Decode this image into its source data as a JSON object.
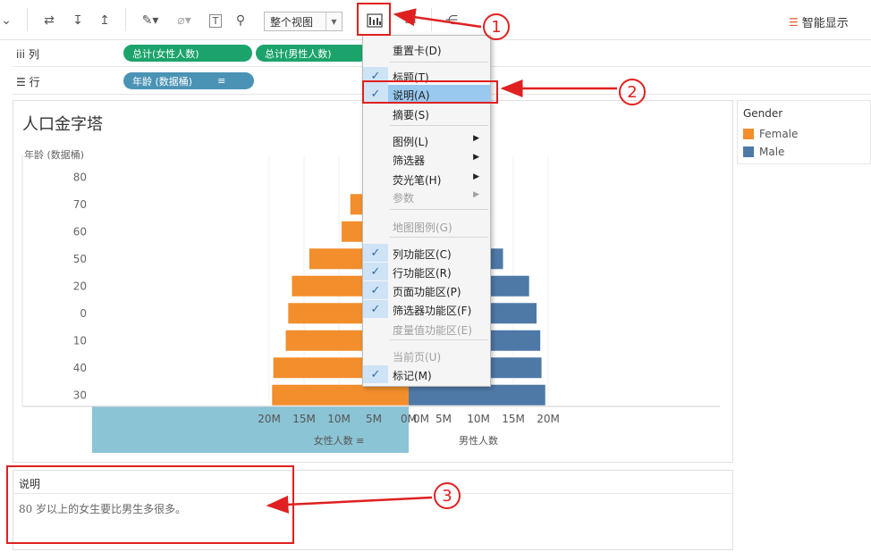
{
  "toolbar": {
    "view_dropdown": "整个视图",
    "smart_show": "智能显示"
  },
  "shelves": {
    "columns_label": "列",
    "rows_label": "行",
    "column_pills": [
      "总计(女性人数)",
      "总计(男性人数)"
    ],
    "row_pills": [
      "年龄 (数据桶)"
    ]
  },
  "sheet": {
    "title": "人口金字塔",
    "y_axis_title": "年龄 (数据桶)"
  },
  "legend": {
    "title": "Gender",
    "items": [
      {
        "label": "Female",
        "color": "#f28e2b"
      },
      {
        "label": "Male",
        "color": "#4e79a7"
      }
    ]
  },
  "chart_data": {
    "type": "bar",
    "categories": [
      "80",
      "70",
      "60",
      "50",
      "20",
      "0",
      "10",
      "40",
      "30"
    ],
    "series": [
      {
        "name": "Female",
        "color": "#f28e2b",
        "values": [
          3.1,
          4.7,
          5.4,
          8.0,
          9.4,
          9.7,
          9.9,
          10.9,
          11.0
        ]
      },
      {
        "name": "Male",
        "color": "#4e79a7",
        "values": [
          0.0,
          3.5,
          4.8,
          7.6,
          9.7,
          10.3,
          10.6,
          10.7,
          11.0
        ]
      }
    ],
    "x_left": {
      "label": "女性人数",
      "ticks": [
        "20M",
        "15M",
        "10M",
        "5M",
        "0M"
      ],
      "range": [
        0,
        20
      ]
    },
    "x_right": {
      "label": "男性人数",
      "ticks": [
        "0M",
        "5M",
        "10M",
        "15M",
        "20M"
      ],
      "range": [
        0,
        20
      ]
    },
    "left_axis_highlight": "#8bc4d4"
  },
  "menu": {
    "items": [
      {
        "label": "重置卡(D)",
        "checked": false,
        "disabled": false,
        "submenu": false
      },
      {
        "label": "标题(T)",
        "checked": true,
        "disabled": false,
        "submenu": false
      },
      {
        "label": "说明(A)",
        "checked": true,
        "disabled": false,
        "submenu": false,
        "highlighted": true
      },
      {
        "label": "摘要(S)",
        "checked": false,
        "disabled": false,
        "submenu": false
      },
      {
        "label": "图例(L)",
        "checked": false,
        "disabled": false,
        "submenu": true
      },
      {
        "label": "筛选器",
        "checked": false,
        "disabled": false,
        "submenu": true
      },
      {
        "label": "荧光笔(H)",
        "checked": false,
        "disabled": false,
        "submenu": true
      },
      {
        "label": "参数",
        "checked": false,
        "disabled": true,
        "submenu": true
      },
      {
        "label": "地图图例(G)",
        "checked": false,
        "disabled": true,
        "submenu": false
      },
      {
        "label": "列功能区(C)",
        "checked": true,
        "disabled": false,
        "submenu": false
      },
      {
        "label": "行功能区(R)",
        "checked": true,
        "disabled": false,
        "submenu": false
      },
      {
        "label": "页面功能区(P)",
        "checked": true,
        "disabled": false,
        "submenu": false
      },
      {
        "label": "筛选器功能区(F)",
        "checked": true,
        "disabled": false,
        "submenu": false
      },
      {
        "label": "度量值功能区(E)",
        "checked": false,
        "disabled": true,
        "submenu": false
      },
      {
        "label": "当前页(U)",
        "checked": false,
        "disabled": true,
        "submenu": false
      },
      {
        "label": "标记(M)",
        "checked": true,
        "disabled": false,
        "submenu": false
      }
    ]
  },
  "caption": {
    "header": "说明",
    "text": "80 岁以上的女生要比男生多很多。"
  },
  "annotations": {
    "step1": "1",
    "step2": "2",
    "step3": "3",
    "color": "#e02020"
  }
}
